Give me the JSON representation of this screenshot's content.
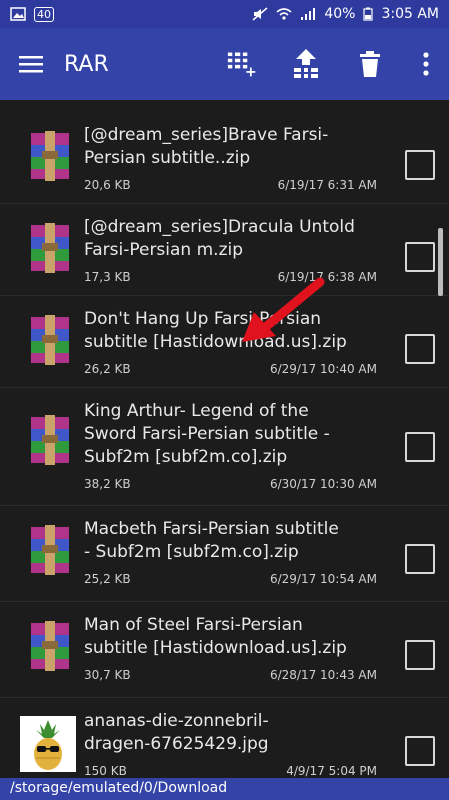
{
  "status_bar": {
    "notification_icon": "gallery-icon",
    "badge_text": "40",
    "mute_icon": "mute-icon",
    "wifi_icon": "wifi-icon",
    "signal_icon": "signal-icon",
    "battery_percent": "40%",
    "battery_icon": "battery-icon",
    "time": "3:05 AM"
  },
  "app_bar": {
    "title": "RAR",
    "menu_icon": "hamburger-menu-icon",
    "actions": [
      {
        "name": "add-to-archive-icon"
      },
      {
        "name": "extract-icon"
      },
      {
        "name": "delete-icon"
      },
      {
        "name": "more-vert-icon"
      }
    ]
  },
  "files": [
    {
      "name_lines": [
        "[@dream_series]Brave Farsi-",
        "Persian subtitle..zip"
      ],
      "size": "20,6 KB",
      "date": "6/19/17 6:31 AM",
      "type": "rar"
    },
    {
      "name_lines": [
        "[@dream_series]Dracula Untold",
        "Farsi-Persian m.zip"
      ],
      "size": "17,3 KB",
      "date": "6/19/17 6:38 AM",
      "type": "rar"
    },
    {
      "name_lines": [
        "Don't Hang Up Farsi-Persian",
        "subtitle [Hastidownload.us].zip"
      ],
      "size": "26,2 KB",
      "date": "6/29/17 10:40 AM",
      "type": "rar"
    },
    {
      "name_lines": [
        "King Arthur- Legend of the",
        "Sword Farsi-Persian subtitle -",
        "Subf2m [subf2m.co].zip"
      ],
      "size": "38,2 KB",
      "date": "6/30/17 10:30 AM",
      "type": "rar"
    },
    {
      "name_lines": [
        "Macbeth Farsi-Persian subtitle",
        "- Subf2m [subf2m.co].zip"
      ],
      "size": "25,2 KB",
      "date": "6/29/17 10:54 AM",
      "type": "rar"
    },
    {
      "name_lines": [
        "Man of Steel Farsi-Persian",
        "subtitle [Hastidownload.us].zip"
      ],
      "size": "30,7 KB",
      "date": "6/28/17 10:43 AM",
      "type": "rar"
    },
    {
      "name_lines": [
        "ananas-die-zonnebril-",
        "dragen-67625429.jpg"
      ],
      "size": "150 KB",
      "date": "4/9/17 5:04 PM",
      "type": "image"
    }
  ],
  "path": "/storage/emulated/0/Download",
  "colors": {
    "appbar": "#3343a8",
    "statusbar": "#2f3a9e",
    "background": "#1c1c1c",
    "annotation_arrow": "#e0121d"
  }
}
